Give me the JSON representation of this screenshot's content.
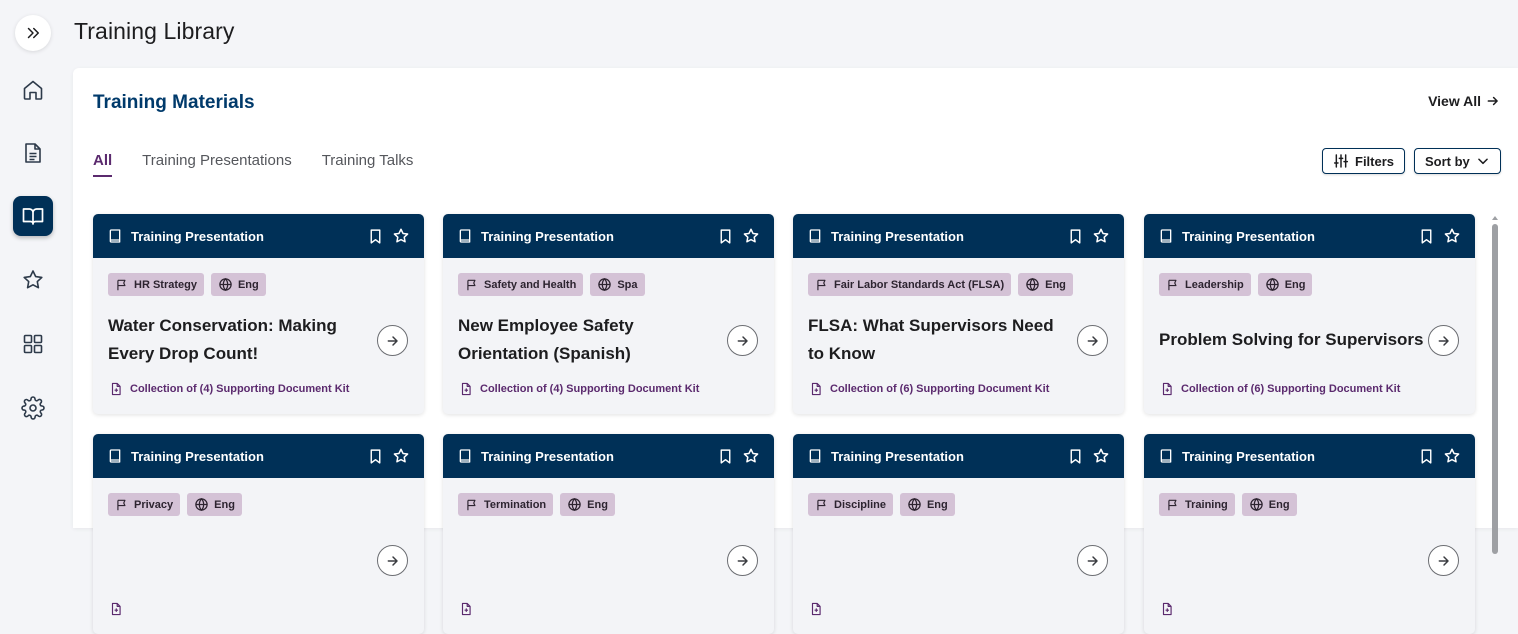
{
  "page": {
    "title": "Training Library"
  },
  "sidebar": {
    "expand_icon": "chevrons-right-icon",
    "items": [
      {
        "name": "home",
        "icon": "home-icon"
      },
      {
        "name": "documents",
        "icon": "document-icon"
      },
      {
        "name": "training-library",
        "icon": "book-open-icon",
        "active": true
      },
      {
        "name": "favorites",
        "icon": "star-icon"
      },
      {
        "name": "apps",
        "icon": "grid-icon"
      },
      {
        "name": "settings",
        "icon": "gear-icon"
      }
    ]
  },
  "section": {
    "title": "Training Materials",
    "view_all": "View All",
    "tabs": [
      {
        "label": "All",
        "active": true
      },
      {
        "label": "Training Presentations"
      },
      {
        "label": "Training Talks"
      }
    ],
    "filters_label": "Filters",
    "sort_label": "Sort by"
  },
  "cards": [
    {
      "type": "Training Presentation",
      "tags": [
        "HR Strategy",
        "Eng"
      ],
      "title": "Water Conservation: Making Every Drop Count!",
      "kit": "Collection of (4) Supporting Document Kit"
    },
    {
      "type": "Training Presentation",
      "tags": [
        "Safety and Health",
        "Spa"
      ],
      "title": "New Employee Safety Orientation (Spanish)",
      "kit": "Collection of (4) Supporting Document Kit"
    },
    {
      "type": "Training Presentation",
      "tags": [
        "Fair Labor Standards Act (FLSA)",
        "Eng"
      ],
      "title": "FLSA: What Supervisors Need to Know",
      "kit": "Collection of (6) Supporting Document Kit"
    },
    {
      "type": "Training Presentation",
      "tags": [
        "Leadership",
        "Eng"
      ],
      "title": "Problem Solving for Supervisors",
      "kit": "Collection of (6) Supporting Document Kit"
    },
    {
      "type": "Training Presentation",
      "tags": [
        "Privacy",
        "Eng"
      ],
      "title": "",
      "kit": ""
    },
    {
      "type": "Training Presentation",
      "tags": [
        "Termination",
        "Eng"
      ],
      "title": "",
      "kit": ""
    },
    {
      "type": "Training Presentation",
      "tags": [
        "Discipline",
        "Eng"
      ],
      "title": "",
      "kit": ""
    },
    {
      "type": "Training Presentation",
      "tags": [
        "Training",
        "Eng"
      ],
      "title": "",
      "kit": ""
    }
  ],
  "colors": {
    "navy": "#003057",
    "heading_blue": "#003a6b",
    "purple": "#5b2a6e",
    "tag_bg": "#d4c2d6"
  }
}
